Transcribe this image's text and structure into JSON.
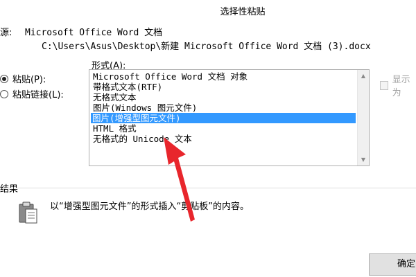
{
  "dialog": {
    "title": "选择性粘贴"
  },
  "source": {
    "label": "源:",
    "line1": "Microsoft Office Word 文档",
    "line2": "C:\\Users\\Asus\\Desktop\\新建 Microsoft Office Word 文档 (3).docx"
  },
  "paste_options": {
    "paste_label": "粘贴(P):",
    "paste_link_label": "粘贴链接(L):",
    "selected": "paste"
  },
  "format": {
    "label": "形式(A):",
    "items": [
      "Microsoft Office Word 文档 对象",
      "带格式文本(RTF)",
      "无格式文本",
      "图片(Windows 图元文件)",
      "图片(增强型图元文件)",
      "HTML 格式",
      "无格式的 Unicode 文本"
    ],
    "selected_index": 4
  },
  "display_as_icon": {
    "label": "显示为"
  },
  "result": {
    "label": "结果",
    "text": "以“增强型图元文件”的形式插入“剪贴板”的内容。",
    "icon": "clipboard-icon"
  },
  "buttons": {
    "ok_label": "确定"
  },
  "annotation": {
    "color": "#e8262c"
  }
}
